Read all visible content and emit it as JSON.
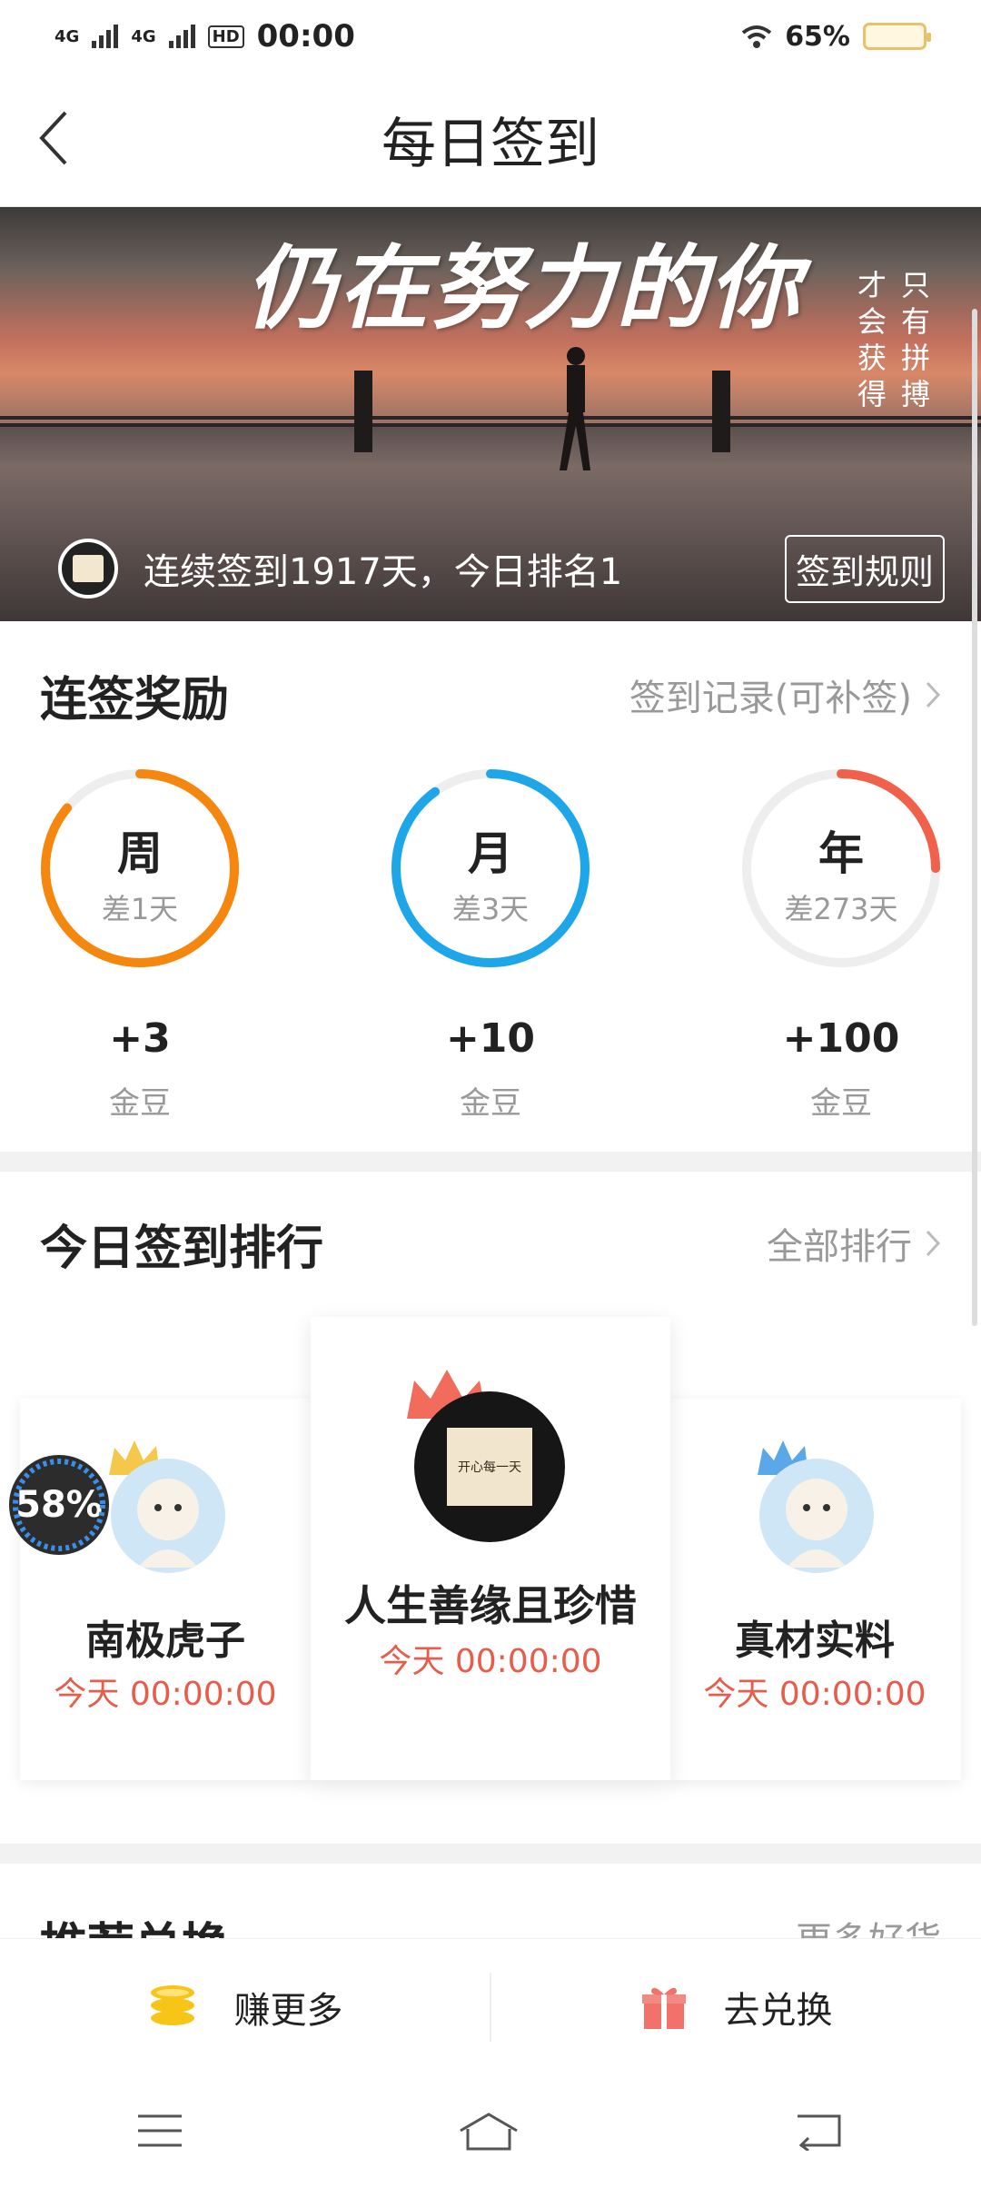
{
  "status": {
    "net1": "4G",
    "net2": "4G",
    "hd": "HD",
    "time": "00:00",
    "battery": "65%"
  },
  "nav": {
    "title": "每日签到"
  },
  "banner": {
    "headline": "仍在努力的你",
    "vertical_left": "才会获得",
    "vertical_right": "只有拼搏",
    "streak_text": "连续签到1917天，今日排名1",
    "rules_label": "签到规则"
  },
  "rewards": {
    "title": "连签奖励",
    "link": "签到记录(可补签)",
    "items": [
      {
        "period": "周",
        "remaining": "差1天",
        "amount": "+3",
        "unit": "金豆",
        "color": "#f5870f",
        "progress": 0.86
      },
      {
        "period": "月",
        "remaining": "差3天",
        "amount": "+10",
        "unit": "金豆",
        "color": "#1ea7e8",
        "progress": 0.9
      },
      {
        "period": "年",
        "remaining": "差273天",
        "amount": "+100",
        "unit": "金豆",
        "color": "#f0604a",
        "progress": 0.25
      }
    ]
  },
  "ranking": {
    "title": "今日签到排行",
    "link": "全部排行",
    "first": {
      "name": "人生善缘且珍惜",
      "time": "今天 00:00:00",
      "avatar_text": "开心每一天"
    },
    "second": {
      "name": "南极虎子",
      "time": "今天 00:00:00"
    },
    "third": {
      "name": "真材实料",
      "time": "今天 00:00:00"
    },
    "progress_badge": "58%"
  },
  "recommend": {
    "title": "推荐兑换",
    "link": "更多好货"
  },
  "bottom": {
    "earn_label": "赚更多",
    "exchange_label": "去兑换"
  }
}
